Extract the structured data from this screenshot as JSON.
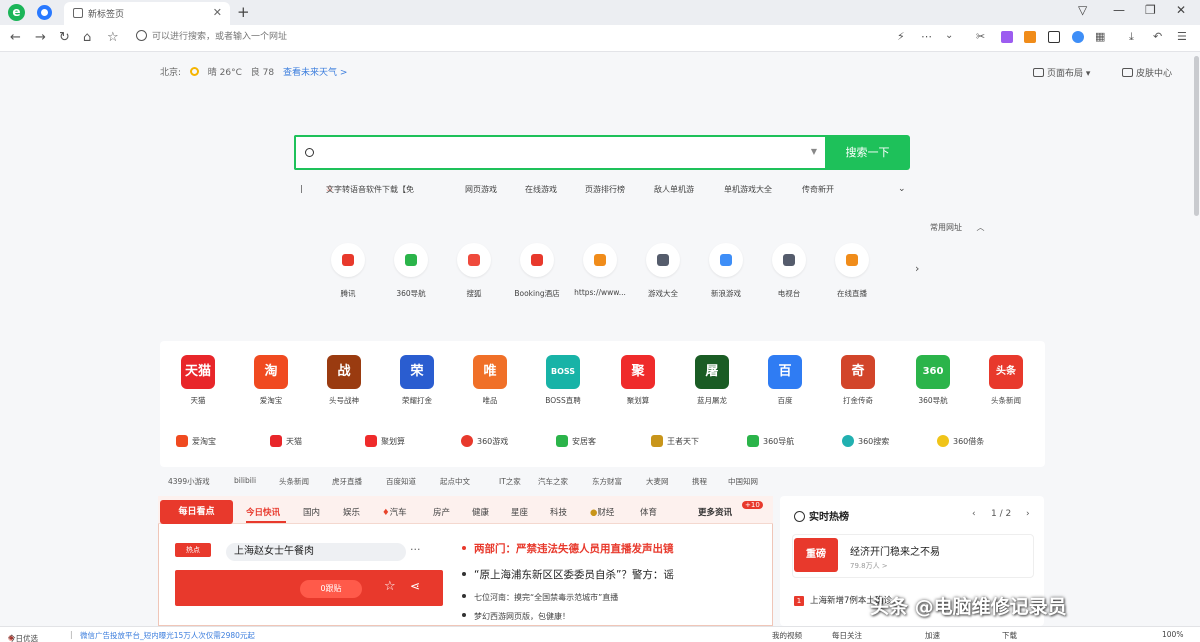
{
  "browser": {
    "tab_title": "新标签页",
    "tab_close": "✕",
    "new_tab": "+",
    "window_controls": [
      "▽",
      "—",
      "❐",
      "✕"
    ],
    "address_placeholder": "可以进行搜索，或者输入一个网址",
    "nav_icons": [
      "←",
      "→",
      "↻",
      "⌂",
      "☆"
    ],
    "toolbar_icons": [
      "lightning-icon",
      "more-icon",
      "chevron-down-icon",
      "scissors-icon",
      "purple-extension-icon",
      "orange-extension-icon",
      "window-icon",
      "blue-circle-icon",
      "grid-icon",
      "download-icon",
      "undo-icon",
      "menu-icon"
    ]
  },
  "weather": {
    "city": "北京:",
    "condition": "晴 26°C",
    "quality": "良 78",
    "link": "查看未来天气 >"
  },
  "top_right": {
    "layout": "页面布局 ▾",
    "skin": "皮肤中心"
  },
  "search": {
    "button": "搜索一下",
    "hotwords": [
      "文字转语音软件下载【免",
      "网页游戏",
      "在线游戏",
      "页游排行榜",
      "敌人单机游",
      "单机游戏大全",
      "传奇新开"
    ]
  },
  "frequent": {
    "label": "常用网址",
    "sites": [
      {
        "label": "腾讯",
        "color": "#e8392c"
      },
      {
        "label": "360导航",
        "color": "#2bb44a"
      },
      {
        "label": "搜狐",
        "color": "#ef4a3c"
      },
      {
        "label": "Booking酒店",
        "color": "#e8392c"
      },
      {
        "label": "https://www...",
        "color": "#f08c1a"
      },
      {
        "label": "游戏大全",
        "color": "#555c6c"
      },
      {
        "label": "新浪游戏",
        "color": "#3e8ef7"
      },
      {
        "label": "电视台",
        "color": "#555c6c"
      },
      {
        "label": "在线直播",
        "color": "#f08c1a"
      }
    ]
  },
  "apps": [
    {
      "label": "天猫",
      "glyph": "天猫",
      "color": "#e8262a"
    },
    {
      "label": "爱淘宝",
      "glyph": "淘",
      "color": "#f04a20"
    },
    {
      "label": "头号战神",
      "glyph": "战",
      "color": "#9a3b10"
    },
    {
      "label": "荣耀打金",
      "glyph": "荣",
      "color": "#2a5dd0"
    },
    {
      "label": "唯品",
      "glyph": "唯",
      "color": "#f07028"
    },
    {
      "label": "BOSS直聘",
      "glyph": "BOSS",
      "color": "#18b3a7"
    },
    {
      "label": "聚划算",
      "glyph": "聚",
      "color": "#ef2b2b"
    },
    {
      "label": "蓝月屠龙",
      "glyph": "屠",
      "color": "#1a5c24"
    },
    {
      "label": "百度",
      "glyph": "百",
      "color": "#2f7cf3"
    },
    {
      "label": "打金传奇",
      "glyph": "奇",
      "color": "#d2452a"
    },
    {
      "label": "360导航",
      "glyph": "360",
      "color": "#2bb44a"
    },
    {
      "label": "头条新闻",
      "glyph": "头条",
      "color": "#e8392c"
    }
  ],
  "sub_apps": [
    {
      "label": "爱淘宝",
      "color": "#f04a20"
    },
    {
      "label": "天猫",
      "color": "#e8262a"
    },
    {
      "label": "聚划算",
      "color": "#ef2b2b"
    },
    {
      "label": "360游戏",
      "color": "#e8392c"
    },
    {
      "label": "安居客",
      "color": "#2bb44a"
    },
    {
      "label": "王者天下",
      "color": "#c8951a"
    },
    {
      "label": "360导航",
      "color": "#2bb44a"
    },
    {
      "label": "360搜索",
      "color": "#21b0b0"
    },
    {
      "label": "360借条",
      "color": "#f0c419"
    }
  ],
  "links": [
    "4399小游戏",
    "bilibili",
    "头条新闻",
    "虎牙直播",
    "百度知道",
    "起点中文",
    "IT之家",
    "汽车之家",
    "东方财富",
    "大麦网",
    "携程",
    "中国知网"
  ],
  "news": {
    "logo": "每日看点",
    "tabs": [
      "今日快讯",
      "国内",
      "娱乐",
      "汽车",
      "房产",
      "健康",
      "星座",
      "科技",
      "财经",
      "体育"
    ],
    "more": "更多资讯",
    "more_badge": "+10",
    "hot_tag": "热点",
    "hot_title": "上海赵女士午餐肉",
    "dots": "···",
    "pill": "0跟贴",
    "lines": [
      "两部门：严禁违法失德人员用直播发声出镜",
      "“原上海浦东新区区委委员自杀”？警方：谣",
      "七位河南：摸完“全国禁毒示范城市”直播",
      "梦幻西游网页版，包健康！"
    ]
  },
  "hotlist": {
    "title": "实时热榜",
    "pager": "1 / 2",
    "badge": "重磅",
    "card_title": "经济开门稳来之不易",
    "card_sub": "79.8万人 >",
    "item": "上海新增7例本土确诊"
  },
  "statusbar": {
    "left": "今日优选",
    "news": "微信广告投放平台_短内曝光15万人次仅需2980元起",
    "items": [
      "我的视频",
      "每日关注",
      "加速",
      "下载",
      "100%"
    ]
  },
  "watermark": "头条 @电脑维修记录员",
  "colors": {
    "accent_green": "#1ec15a",
    "news_red": "#e8392c",
    "link_blue": "#3b7ddd"
  }
}
